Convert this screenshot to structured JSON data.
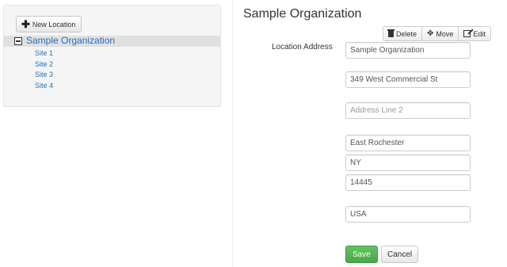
{
  "tree": {
    "new_location_label": "New Location",
    "root_label": "Sample Organization",
    "children": [
      "Site 1",
      "Site 2",
      "Site 3",
      "Site 4"
    ]
  },
  "detail": {
    "title": "Sample Organization",
    "actions": {
      "delete_label": "Delete",
      "move_label": "Move",
      "edit_label": "Edit"
    },
    "address_label": "Location Address",
    "fields": {
      "name_value": "Sample Organization",
      "line1_value": "349 West Commercial St",
      "line2_value": "",
      "line2_placeholder": "Address Line 2",
      "city_value": "East Rochester",
      "state_value": "NY",
      "zip_value": "14445",
      "country_value": "USA"
    },
    "save_label": "Save",
    "cancel_label": "Cancel"
  },
  "icons": {
    "new_location": "plus-icon",
    "tree_toggle": "collapse-square-icon",
    "delete": "trash-icon",
    "move": "move-arrows-icon",
    "edit": "edit-icon"
  },
  "colors": {
    "link": "#2a6ebb",
    "save_button": "#5bb75b",
    "panel_background": "#f5f5f5",
    "selected_row": "#e0e0e0"
  }
}
